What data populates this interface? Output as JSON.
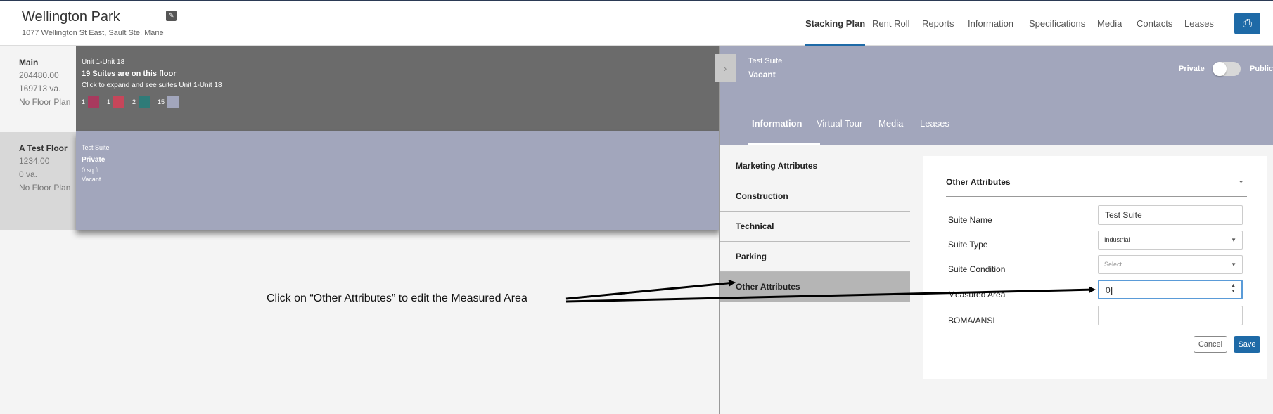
{
  "header": {
    "property_name": "Wellington Park",
    "address": "1077 Wellington St East, Sault Ste. Marie",
    "nav": [
      "Stacking Plan",
      "Rent Roll",
      "Reports",
      "Information",
      "Specifications",
      "Media",
      "Contacts",
      "Leases"
    ],
    "active_nav": "Stacking Plan"
  },
  "floors": {
    "main": {
      "name": "Main",
      "value1": "204480.00",
      "value2": "169713 va.",
      "floor_plan": "No Floor Plan",
      "units_range": "Unit 1-Unit 18",
      "suites_summary": "19 Suites are on this floor",
      "expand_hint": "Click to expand and see suites Unit 1-Unit 18",
      "legend": [
        {
          "count": "1",
          "color": "#a83a5e"
        },
        {
          "count": "1",
          "color": "#c6465a"
        },
        {
          "count": "2",
          "color": "#2f7b78"
        },
        {
          "count": "15",
          "color": "#a2a6bc"
        }
      ]
    },
    "test": {
      "name": "A Test Floor",
      "value1": "1234.00",
      "value2": "0 va.",
      "floor_plan": "No Floor Plan",
      "suite_name": "Test Suite",
      "visibility": "Private",
      "area": "0 sq.ft.",
      "status": "Vacant"
    }
  },
  "annotation": {
    "text": "Click on “Other Attributes” to edit the Measured Area"
  },
  "panel": {
    "suite_name": "Test Suite",
    "status": "Vacant",
    "private_label": "Private",
    "public_label": "Public",
    "toggle_public": false,
    "tabs": [
      "Information",
      "Virtual Tour",
      "Media",
      "Leases"
    ],
    "active_tab": "Information",
    "menu": [
      "Marketing Attributes",
      "Construction",
      "Technical",
      "Parking",
      "Other Attributes"
    ],
    "active_menu": "Other Attributes",
    "form": {
      "title": "Other Attributes",
      "fields": {
        "suite_name": {
          "label": "Suite Name",
          "value": "Test Suite"
        },
        "suite_type": {
          "label": "Suite Type",
          "value": "Industrial"
        },
        "suite_condition": {
          "label": "Suite Condition",
          "placeholder": "Select..."
        },
        "measured_area": {
          "label": "Measured Area",
          "value": "0"
        },
        "boma": {
          "label": "BOMA/ANSI",
          "value": ""
        }
      },
      "cancel_label": "Cancel",
      "save_label": "Save"
    }
  },
  "colors": {
    "accent": "#1e6aa7",
    "panel_header": "#a2a6bc",
    "main_floor": "#6b6b6b"
  }
}
